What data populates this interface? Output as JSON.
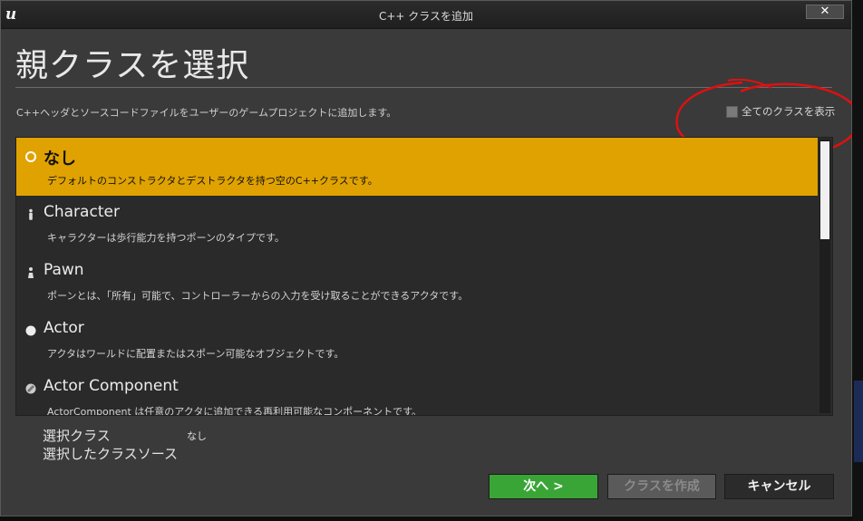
{
  "window": {
    "title": "C++ クラスを追加",
    "close_label": "✕"
  },
  "heading": "親クラスを選択",
  "description": "C++ヘッダとソースコードファイルをユーザーのゲームプロジェクトに追加します。",
  "show_all_label": "全てのクラスを表示",
  "show_all_checked": false,
  "class_list": [
    {
      "name": "なし",
      "description": "デフォルトのコンストラクタとデストラクタを持つ空のC++クラスです。",
      "icon": "circle-outline-icon",
      "selected": true
    },
    {
      "name": "Character",
      "description": "キャラクターは歩行能力を持つポーンのタイプです。",
      "icon": "character-icon",
      "selected": false
    },
    {
      "name": "Pawn",
      "description": "ポーンとは、「所有」可能で、コントローラーからの入力を受け取ることができるアクタです。",
      "icon": "pawn-icon",
      "selected": false
    },
    {
      "name": "Actor",
      "description": "アクタはワールドに配置またはスポーン可能なオブジェクトです。",
      "icon": "actor-sphere-icon",
      "selected": false
    },
    {
      "name": "Actor Component",
      "description": "ActorComponent は任意のアクタに追加できる再利用可能なコンポーネントです。",
      "icon": "component-icon",
      "selected": false
    }
  ],
  "selection_info": {
    "selected_class_label": "選択クラス",
    "selected_class_value": "なし",
    "selected_source_label": "選択したクラスソース"
  },
  "buttons": {
    "next": "次へ >",
    "create": "クラスを作成",
    "cancel": "キャンセル"
  },
  "colors": {
    "selected_row": "#e0a200",
    "next_button": "#3aa537",
    "annotation": "#e01010"
  }
}
